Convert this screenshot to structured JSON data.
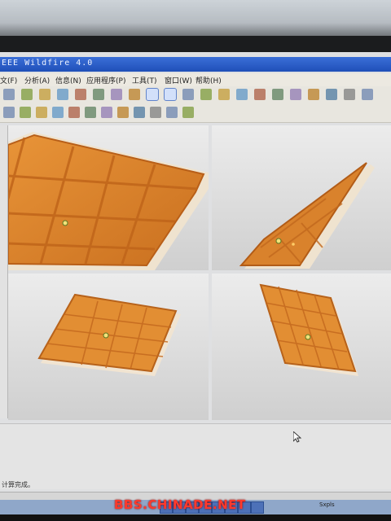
{
  "window": {
    "title": "EEE Wildfire 4.0"
  },
  "menu": {
    "items": [
      "文(F)",
      "分析(A)",
      "信息(N)",
      "应用程序(P)",
      "工具(T)",
      "窗口(W)",
      "帮助(H)"
    ]
  },
  "toolbar1_icons": [
    "undo-icon",
    "redo-icon",
    "cut-icon",
    "copy-icon",
    "paste-icon",
    "regenerate-icon",
    "find-icon",
    "model-tree-icon",
    "view-icon",
    "sketch-icon",
    "repaint-icon",
    "zoom-in-icon",
    "zoom-out-icon",
    "refit-icon",
    "orient-icon",
    "saved-views-icon",
    "layers-icon",
    "shading-icon",
    "hidden-line-icon",
    "wireframe-icon",
    "no-hidden-icon"
  ],
  "toolbar2_icons": [
    "datum-plane-icon",
    "datum-axis-icon",
    "datum-point-icon",
    "coordinate-system-icon",
    "analysis-icon",
    "sketch-tool-icon",
    "extrude-icon",
    "revolve-icon",
    "sweep-icon",
    "blend-icon",
    "round-icon",
    "mirror-icon"
  ],
  "status": {
    "left": "计算完成。",
    "right": "Sxpls"
  },
  "watermark": "BBS.CHINADE.NET",
  "colors": {
    "part": "#e08a2c",
    "part_dark": "#b5611a",
    "part_light": "#f4b35b",
    "viewport_bg": "#e3e3e3"
  }
}
